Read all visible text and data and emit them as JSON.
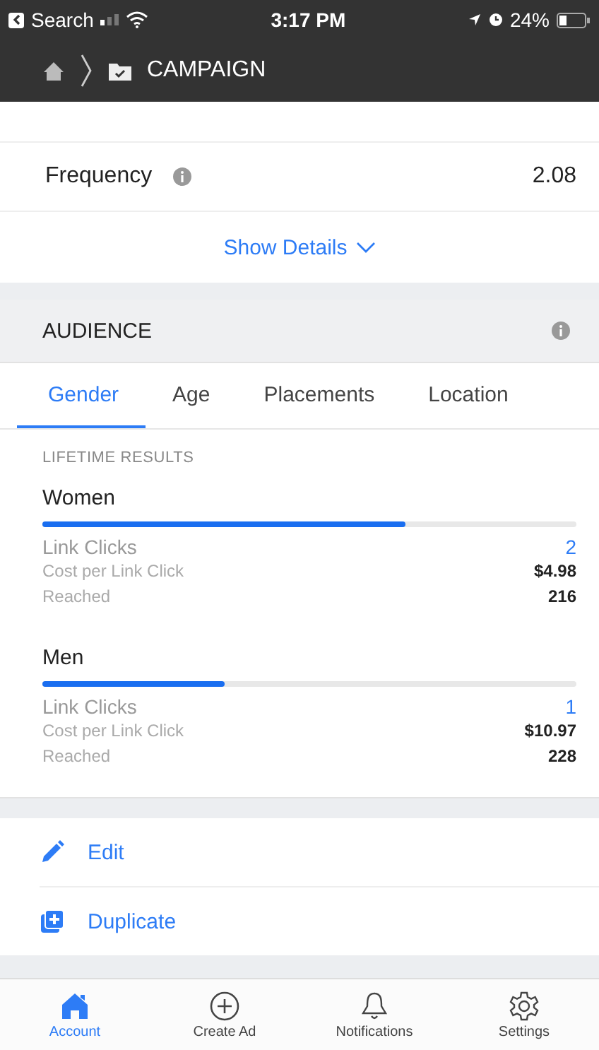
{
  "status_bar": {
    "back": "Search",
    "time": "3:17 PM",
    "battery": "24%"
  },
  "nav": {
    "title": "CAMPAIGN"
  },
  "metrics": [
    {
      "label": "Frequency",
      "value": "2.08"
    }
  ],
  "show_details": "Show Details",
  "audience": {
    "title": "AUDIENCE",
    "tabs": [
      {
        "label": "Gender",
        "selected": true
      },
      {
        "label": "Age",
        "selected": false
      },
      {
        "label": "Placements",
        "selected": false
      },
      {
        "label": "Location",
        "selected": false
      }
    ],
    "section": "LIFETIME RESULTS",
    "groups": [
      {
        "name": "Women",
        "level": 0.68,
        "rows": [
          {
            "label": "Link Clicks",
            "value": "2",
            "kind": "primary"
          },
          {
            "label": "Cost per Link Click",
            "value": "$4.98",
            "kind": "secondary"
          },
          {
            "label": "Reached",
            "value": "216",
            "kind": "secondary"
          }
        ]
      },
      {
        "name": "Men",
        "level": 0.34,
        "rows": [
          {
            "label": "Link Clicks",
            "value": "1",
            "kind": "primary"
          },
          {
            "label": "Cost per Link Click",
            "value": "$10.97",
            "kind": "secondary"
          },
          {
            "label": "Reached",
            "value": "228",
            "kind": "secondary"
          }
        ]
      }
    ]
  },
  "actions": [
    {
      "label": "Edit",
      "kind": "edit"
    },
    {
      "label": "Duplicate",
      "kind": "duplicate"
    }
  ],
  "tab_bar": [
    {
      "label": "Account",
      "kind": "home",
      "selected": true
    },
    {
      "label": "Create Ad",
      "kind": "plus",
      "selected": false
    },
    {
      "label": "Notifications",
      "kind": "bell",
      "selected": false
    },
    {
      "label": "Settings",
      "kind": "gear",
      "selected": false
    }
  ]
}
